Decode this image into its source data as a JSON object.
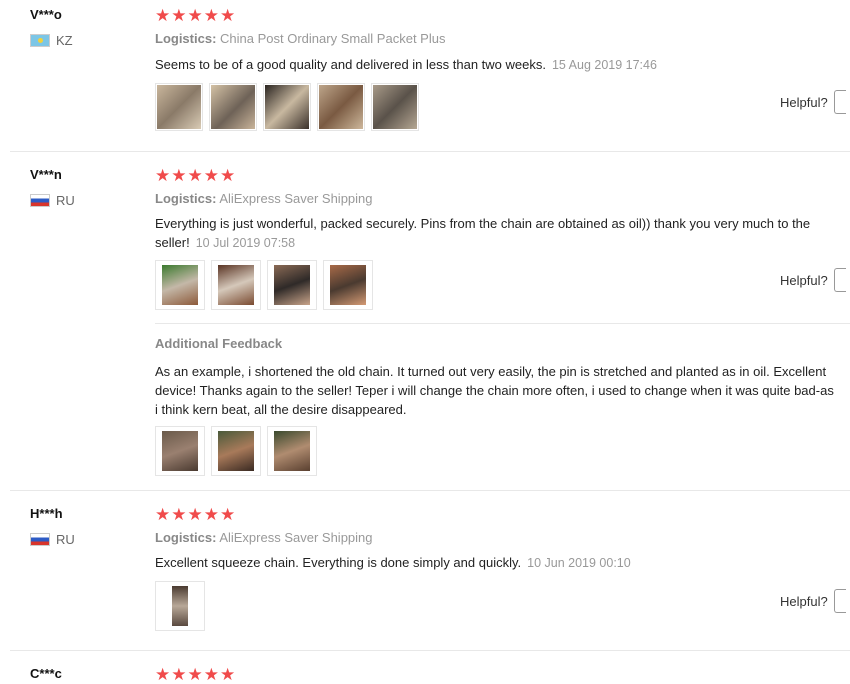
{
  "reviews": [
    {
      "user": "V***o",
      "country": "KZ",
      "flag": "kazakhstan-flag",
      "stars": "★★★★★",
      "logistics_label": "Logistics:",
      "logistics": "China Post Ordinary Small Packet Plus",
      "text": "Seems to be of a good quality and delivered in less than two weeks.",
      "date": "15 Aug 2019 17:46",
      "helpful": "Helpful?"
    },
    {
      "user": "V***n",
      "country": "RU",
      "flag": "russia-flag",
      "stars": "★★★★★",
      "logistics_label": "Logistics:",
      "logistics": "AliExpress Saver Shipping",
      "text": "Everything is just wonderful, packed securely. Pins from the chain are obtained as oil)) thank you very much to the seller!",
      "date": "10 Jul 2019 07:58",
      "helpful": "Helpful?",
      "additional_title": "Additional Feedback",
      "additional_text": "As an example, i shortened the old chain. It turned out very easily, the pin is stretched and planted as in oil. Excellent device! Thanks again to the seller! Teper i will change the chain more often, i used to change when it was quite bad-as i think kern beat, all the desire disappeared."
    },
    {
      "user": "H***h",
      "country": "RU",
      "flag": "russia-flag",
      "stars": "★★★★★",
      "logistics_label": "Logistics:",
      "logistics": "AliExpress Saver Shipping",
      "text": "Excellent squeeze chain. Everything is done simply and quickly.",
      "date": "10 Jun 2019 00:10",
      "helpful": "Helpful?"
    },
    {
      "user": "C***c",
      "stars": "★★★★★"
    }
  ],
  "colors": {
    "star": "#f04b4b",
    "muted": "#999999",
    "separator": "#e8e8e8"
  }
}
